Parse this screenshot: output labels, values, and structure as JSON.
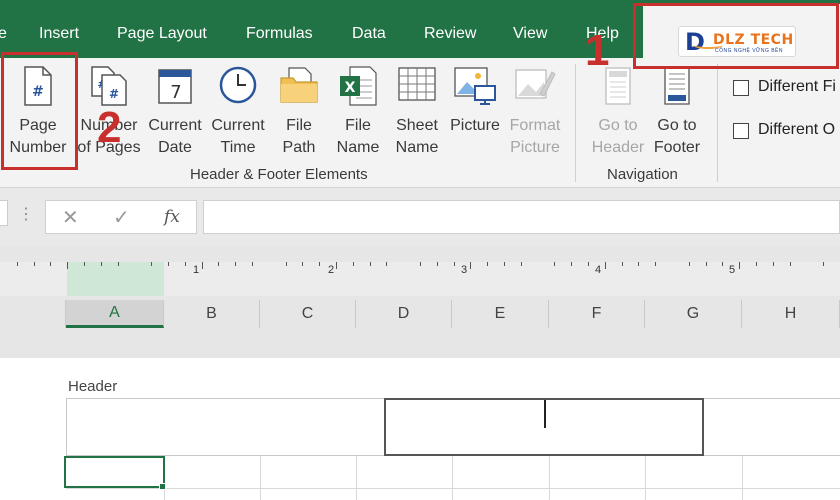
{
  "tabs": [
    {
      "label": "e"
    },
    {
      "label": "Insert"
    },
    {
      "label": "Page Layout"
    },
    {
      "label": "Formulas"
    },
    {
      "label": "Data"
    },
    {
      "label": "Review"
    },
    {
      "label": "View"
    },
    {
      "label": "Help"
    }
  ],
  "logo": {
    "brand": "DLZ TECH",
    "tagline": "CÔNG NGHỆ VỮNG BỀN"
  },
  "ribbon": {
    "buttons": [
      {
        "line1": "Page",
        "line2": "Number",
        "icon": "page-number-icon"
      },
      {
        "line1": "Number",
        "line2": "of Pages",
        "icon": "number-of-pages-icon"
      },
      {
        "line1": "Current",
        "line2": "Date",
        "icon": "calendar-icon"
      },
      {
        "line1": "Current",
        "line2": "Time",
        "icon": "clock-icon"
      },
      {
        "line1": "File",
        "line2": "Path",
        "icon": "folder-icon"
      },
      {
        "line1": "File",
        "line2": "Name",
        "icon": "excel-file-icon"
      },
      {
        "line1": "Sheet",
        "line2": "Name",
        "icon": "sheet-icon"
      },
      {
        "line1": "Picture",
        "line2": "",
        "icon": "picture-icon"
      },
      {
        "line1": "Format",
        "line2": "Picture",
        "icon": "format-picture-icon"
      },
      {
        "line1": "Go to",
        "line2": "Header",
        "icon": "go-to-header-icon"
      },
      {
        "line1": "Go to",
        "line2": "Footer",
        "icon": "go-to-footer-icon"
      }
    ],
    "groups": {
      "elements": "Header & Footer Elements",
      "navigation": "Navigation"
    },
    "options": [
      {
        "label": "Different Fi"
      },
      {
        "label": "Different O"
      }
    ],
    "calendar_day": "7",
    "page_symbol": "#"
  },
  "formula_bar": {
    "dots": "⋮",
    "cancel": "✕",
    "enter": "✓",
    "fx": "fx",
    "value": ""
  },
  "ruler": {
    "numbers": [
      "1",
      "2",
      "3",
      "4",
      "5"
    ]
  },
  "columns": [
    "A",
    "B",
    "C",
    "D",
    "E",
    "F",
    "G",
    "H"
  ],
  "selected_column": "A",
  "page": {
    "header_label": "Header"
  },
  "annotations": [
    "1",
    "2"
  ],
  "colors": {
    "excel_green": "#217346",
    "annotation_red": "#c8302d",
    "logo_blue": "#1b3f93",
    "logo_orange": "#e8731b"
  }
}
